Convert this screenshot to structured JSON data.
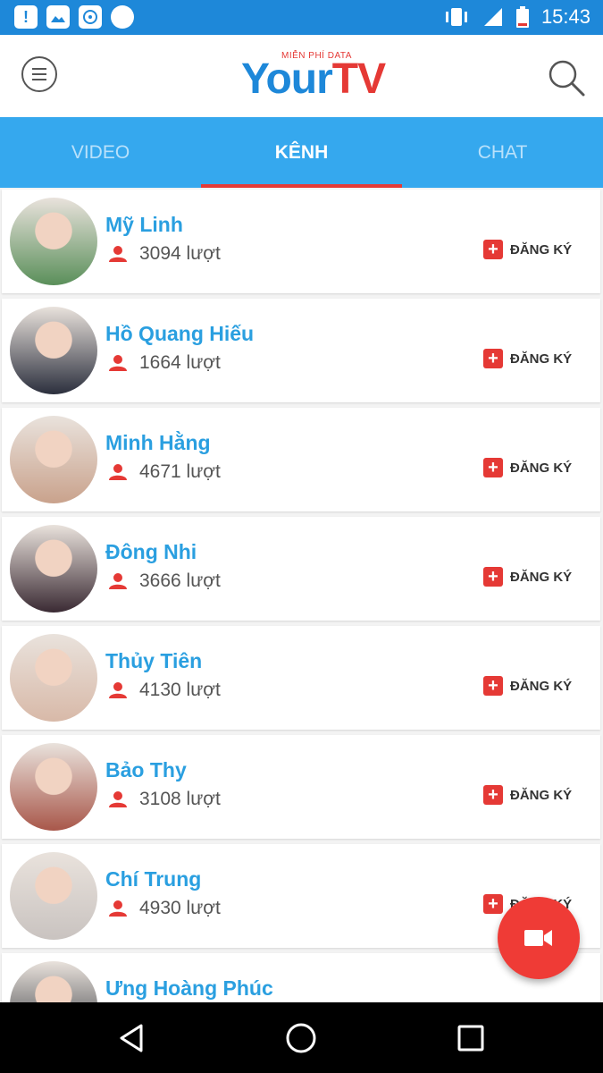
{
  "status_bar": {
    "time": "15:43",
    "left_icons": [
      "alert-icon",
      "image-icon",
      "app-icon",
      "circle-icon"
    ],
    "right_icons": [
      "vibrate-icon",
      "signal-icon",
      "battery-icon"
    ]
  },
  "app_bar": {
    "logo_small": "MIỄN PHÍ DATA",
    "logo_main": "Your",
    "logo_accent": "TV",
    "menu_icon": "menu-icon",
    "search_icon": "search-icon"
  },
  "tabs": [
    {
      "label": "VIDEO",
      "active": false
    },
    {
      "label": "KÊNH",
      "active": true
    },
    {
      "label": "CHAT",
      "active": false
    }
  ],
  "channels": [
    {
      "name": "Mỹ Linh",
      "views": "3094 lượt",
      "subscribe": "ĐĂNG KÝ",
      "avatar_color": "#5a8f5a"
    },
    {
      "name": "Hồ Quang Hiếu",
      "views": "1664 lượt",
      "subscribe": "ĐĂNG KÝ",
      "avatar_color": "#2b2f3d"
    },
    {
      "name": "Minh Hằng",
      "views": "4671 lượt",
      "subscribe": "ĐĂNG KÝ",
      "avatar_color": "#c9a28c"
    },
    {
      "name": "Đông Nhi",
      "views": "3666 lượt",
      "subscribe": "ĐĂNG KÝ",
      "avatar_color": "#3a2a33"
    },
    {
      "name": "Thủy Tiên",
      "views": "4130 lượt",
      "subscribe": "ĐĂNG KÝ",
      "avatar_color": "#d8b9a8"
    },
    {
      "name": "Bảo Thy",
      "views": "3108 lượt",
      "subscribe": "ĐĂNG KÝ",
      "avatar_color": "#a8574a"
    },
    {
      "name": "Chí Trung",
      "views": "4930 lượt",
      "subscribe": "ĐĂNG KÝ",
      "avatar_color": "#c9c3c0"
    },
    {
      "name": "Ưng Hoàng Phúc",
      "views": "",
      "subscribe": "",
      "avatar_color": "#2e3238"
    }
  ],
  "fab": {
    "icon": "video-camera-icon",
    "color": "#ef3b36"
  },
  "nav_bar": {
    "buttons": [
      "back-icon",
      "home-icon",
      "recents-icon"
    ]
  },
  "colors": {
    "primary": "#35a8ee",
    "accent": "#e53935",
    "name": "#2a9fe0"
  }
}
